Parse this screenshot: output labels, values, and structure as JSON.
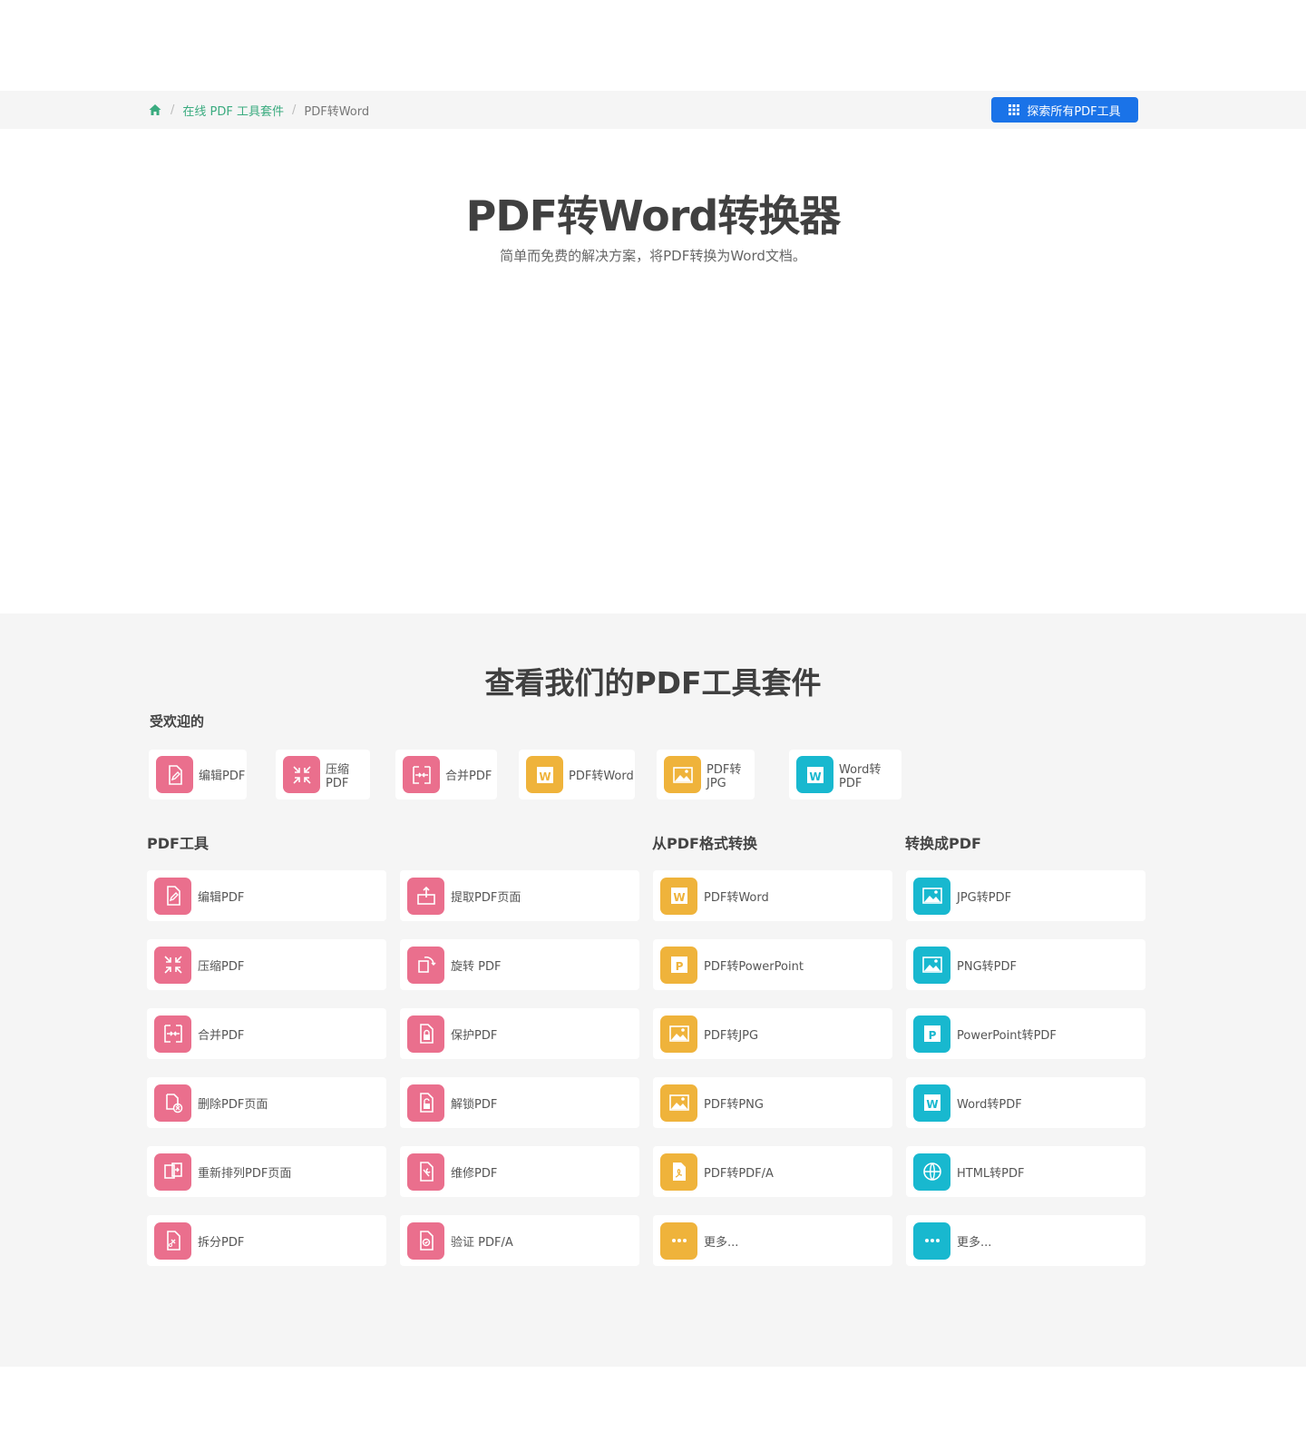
{
  "breadcrumb": {
    "home_icon": "home-icon",
    "items": [
      "在线 PDF 工具套件",
      "PDF转Word"
    ],
    "separator": "/"
  },
  "explore_button": {
    "label": "探索所有PDF工具",
    "icon": "grid-icon"
  },
  "hero": {
    "title": "PDF转Word转换器",
    "subtitle": "简单而免费的解决方案，将PDF转换为Word文档。"
  },
  "suite": {
    "title": "查看我们的PDF工具套件",
    "popular_label": "受欢迎的",
    "popular": [
      {
        "label": "编辑PDF",
        "icon": "edit-pdf-icon",
        "color": "#ea6f8d"
      },
      {
        "label": "压缩PDF",
        "icon": "compress-icon",
        "color": "#ea6f8d"
      },
      {
        "label": "合并PDF",
        "icon": "merge-icon",
        "color": "#ea6f8d"
      },
      {
        "label": "PDF转Word",
        "icon": "word-icon",
        "color": "#efb33b"
      },
      {
        "label": "PDF转JPG",
        "icon": "image-icon",
        "color": "#efb33b"
      },
      {
        "label": "Word转PDF",
        "icon": "word-icon",
        "color": "#18b8cf"
      }
    ],
    "columns": {
      "pdf_tools": "PDF工具",
      "from_pdf": "从PDF格式转换",
      "to_pdf": "转换成PDF"
    },
    "pdf_tools_a": [
      {
        "label": "编辑PDF",
        "icon": "edit-pdf-icon"
      },
      {
        "label": "压缩PDF",
        "icon": "compress-icon"
      },
      {
        "label": "合并PDF",
        "icon": "merge-icon"
      },
      {
        "label": "删除PDF页面",
        "icon": "delete-pages-icon"
      },
      {
        "label": "重新排列PDF页面",
        "icon": "reorder-icon"
      },
      {
        "label": "拆分PDF",
        "icon": "split-icon"
      }
    ],
    "pdf_tools_b": [
      {
        "label": "提取PDF页面",
        "icon": "extract-icon"
      },
      {
        "label": "旋转 PDF",
        "icon": "rotate-icon"
      },
      {
        "label": "保护PDF",
        "icon": "lock-icon"
      },
      {
        "label": "解锁PDF",
        "icon": "unlock-icon"
      },
      {
        "label": "维修PDF",
        "icon": "repair-icon"
      },
      {
        "label": "验证 PDF/A",
        "icon": "validate-icon"
      }
    ],
    "from_pdf_items": [
      {
        "label": "PDF转Word",
        "icon": "word-icon"
      },
      {
        "label": "PDF转PowerPoint",
        "icon": "powerpoint-icon"
      },
      {
        "label": "PDF转JPG",
        "icon": "image-icon"
      },
      {
        "label": "PDF转PNG",
        "icon": "image-icon"
      },
      {
        "label": "PDF转PDF/A",
        "icon": "pdfa-icon"
      },
      {
        "label": "更多...",
        "icon": "more-icon"
      }
    ],
    "to_pdf_items": [
      {
        "label": "JPG转PDF",
        "icon": "image-icon"
      },
      {
        "label": "PNG转PDF",
        "icon": "image-icon"
      },
      {
        "label": "PowerPoint转PDF",
        "icon": "powerpoint-icon"
      },
      {
        "label": "Word转PDF",
        "icon": "word-icon"
      },
      {
        "label": "HTML转PDF",
        "icon": "globe-icon"
      },
      {
        "label": "更多...",
        "icon": "more-icon"
      }
    ]
  }
}
